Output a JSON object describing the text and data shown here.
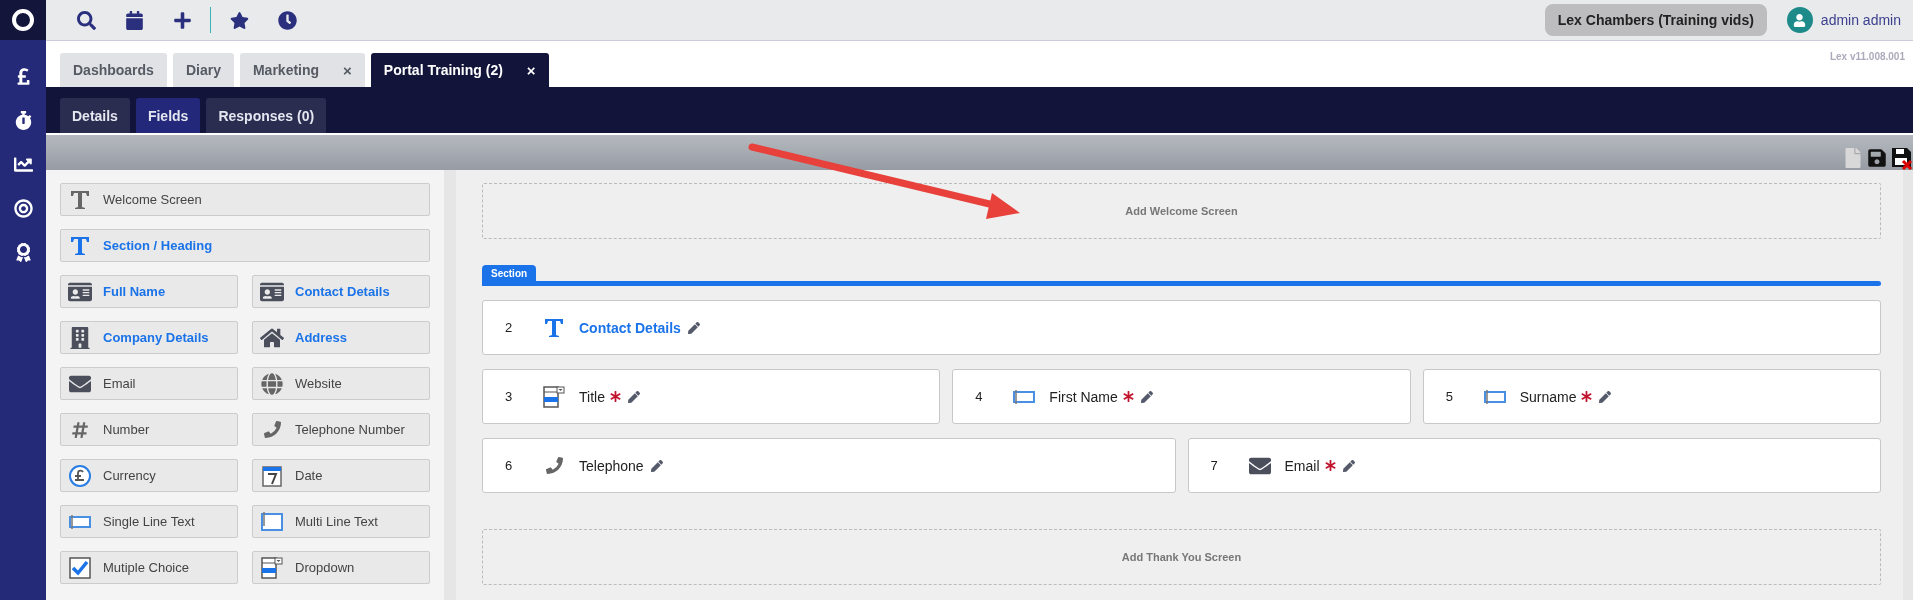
{
  "topbar": {
    "org": "Lex Chambers (Training vids)",
    "user": "admin admin"
  },
  "tabs": [
    {
      "label": "Dashboards",
      "selected": false
    },
    {
      "label": "Diary",
      "selected": false
    },
    {
      "label": "Marketing",
      "selected": false,
      "close": "×"
    },
    {
      "label": "Portal Training (2)",
      "selected": true,
      "close": "×"
    }
  ],
  "version": "Lex v11.008.001",
  "subtabs": [
    {
      "label": "Details",
      "selected": false
    },
    {
      "label": "Fields",
      "selected": true
    },
    {
      "label": "Responses (0)",
      "selected": false
    }
  ],
  "palette": {
    "wide_items": [
      {
        "label": "Welcome Screen",
        "kind": "text",
        "preset": false
      },
      {
        "label": "Section / Heading",
        "kind": "text",
        "preset": true
      }
    ],
    "items": [
      {
        "label": "Full Name",
        "kind": "card",
        "preset": true
      },
      {
        "label": "Contact Details",
        "kind": "card",
        "preset": true
      },
      {
        "label": "Company Details",
        "kind": "building",
        "preset": true
      },
      {
        "label": "Address",
        "kind": "house",
        "preset": true
      },
      {
        "label": "Email",
        "kind": "envelope",
        "preset": false
      },
      {
        "label": "Website",
        "kind": "globe",
        "preset": false
      },
      {
        "label": "Number",
        "kind": "hash",
        "preset": false
      },
      {
        "label": "Telephone Number",
        "kind": "phone",
        "preset": false
      },
      {
        "label": "Currency",
        "kind": "pound",
        "preset": false
      },
      {
        "label": "Date",
        "kind": "date",
        "preset": false
      },
      {
        "label": "Single Line Text",
        "kind": "singleline",
        "preset": false
      },
      {
        "label": "Multi Line Text",
        "kind": "multiline",
        "preset": false
      },
      {
        "label": "Mutiple Choice",
        "kind": "checkbox",
        "preset": false
      },
      {
        "label": "Dropdown",
        "kind": "dropdown",
        "preset": false
      }
    ]
  },
  "canvas": {
    "welcome": "Add Welcome Screen",
    "section_tag": "Section",
    "rows": [
      [
        {
          "number": "2",
          "label": "Contact Details",
          "kind": "heading",
          "required": false
        }
      ],
      [
        {
          "number": "3",
          "label": "Title",
          "kind": "dropdown",
          "required": true
        },
        {
          "number": "4",
          "label": "First Name",
          "kind": "singleline",
          "required": true
        },
        {
          "number": "5",
          "label": "Surname",
          "kind": "singleline",
          "required": true
        }
      ],
      [
        {
          "number": "6",
          "label": "Telephone",
          "kind": "phone",
          "required": false
        },
        {
          "number": "7",
          "label": "Email",
          "kind": "envelope",
          "required": true
        }
      ]
    ],
    "thankyou": "Add Thank You Screen"
  }
}
